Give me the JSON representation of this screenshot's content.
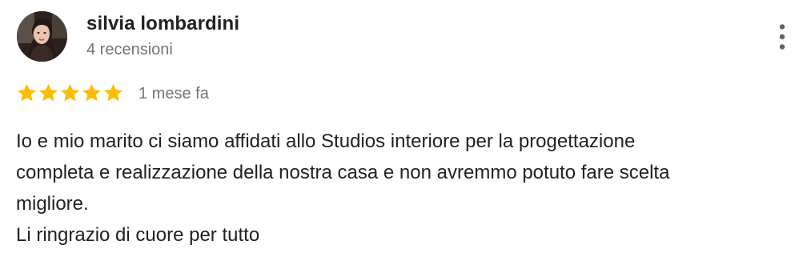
{
  "review": {
    "author": {
      "name": "silvia lombardini",
      "reviews_count": "4 recensioni",
      "avatar_icon": "profile-photo"
    },
    "more_options_icon": "more-vert-icon",
    "rating": 5,
    "rating_max": 5,
    "star_color": "#fbbc04",
    "time": "1 mese fa",
    "text_lines": [
      "Io e mio marito ci siamo affidati allo Studios interiore per la progettazione",
      "completa e realizzazione della nostra casa e non avremmo potuto fare scelta",
      "migliore.",
      "Li ringrazio di cuore per tutto"
    ]
  }
}
